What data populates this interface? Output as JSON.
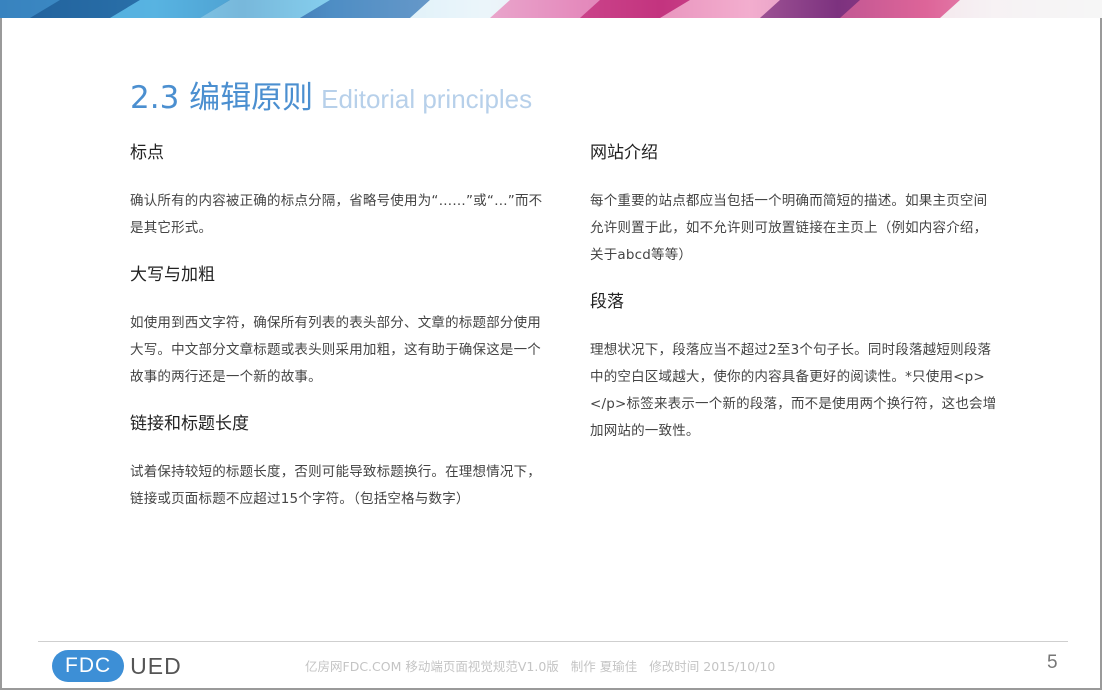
{
  "title": {
    "zh": "2.3 编辑原则",
    "en": "Editorial principles"
  },
  "left_sections": [
    {
      "heading": "标点",
      "body": "确认所有的内容被正确的标点分隔，省略号使用为“……”或“…”而不是其它形式。"
    },
    {
      "heading": "大写与加粗",
      "body": "如使用到西文字符，确保所有列表的表头部分、文章的标题部分使用大写。中文部分文章标题或表头则采用加粗，这有助于确保这是一个故事的两行还是一个新的故事。"
    },
    {
      "heading": "链接和标题长度",
      "body": "试着保持较短的标题长度，否则可能导致标题换行。在理想情况下，链接或页面标题不应超过15个字符。（包括空格与数字）"
    }
  ],
  "right_sections": [
    {
      "heading": "网站介绍",
      "body": "每个重要的站点都应当包括一个明确而简短的描述。如果主页空间允许则置于此，如不允许则可放置链接在主页上（例如内容介绍，关于abcd等等）"
    },
    {
      "heading": "段落",
      "body": "理想状况下，段落应当不超过2至3个句子长。同时段落越短则段落中的空白区域越大，使你的内容具备更好的阅读性。*只使用<p></p>标签来表示一个新的段落，而不是使用两个换行符，这也会增加网站的一致性。"
    }
  ],
  "footer": {
    "logo_left": "FDC",
    "logo_right": "UED",
    "doc_info": "亿房网FDC.COM 移动端页面视觉规范V1.0版",
    "author": "制作 夏瑜佳",
    "modified": "修改时间  2015/10/10",
    "page_number": "5"
  },
  "colors": {
    "title": "#4b8fd0",
    "title_en": "#b7d0ea",
    "logo_bg": "#3d8fd6"
  }
}
